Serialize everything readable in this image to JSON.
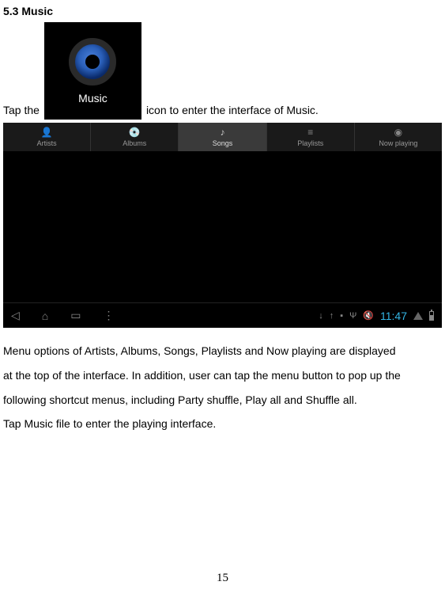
{
  "section": {
    "title": "5.3 Music",
    "tap_prefix": "Tap the",
    "tap_suffix": "icon to enter the interface of Music.",
    "icon_label": "Music"
  },
  "tablet": {
    "tabs": [
      {
        "label": "Artists",
        "icon": "👤"
      },
      {
        "label": "Albums",
        "icon": "💿"
      },
      {
        "label": "Songs",
        "icon": "♪"
      },
      {
        "label": "Playlists",
        "icon": "≡"
      },
      {
        "label": "Now playing",
        "icon": "◉"
      }
    ],
    "clock": "11:47",
    "nav_icons": {
      "back": "◁",
      "home": "⌂",
      "recent": "▭",
      "menu": "⋮"
    }
  },
  "body": {
    "p1": "Menu options of Artists, Albums, Songs, Playlists and Now playing are displayed",
    "p2": "at the top of the interface. In addition, user can tap the menu button to pop up the",
    "p3": "following shortcut menus, including Party shuffle, Play all and Shuffle all.",
    "p4": "Tap Music file to enter the playing interface."
  },
  "page_number": "15"
}
